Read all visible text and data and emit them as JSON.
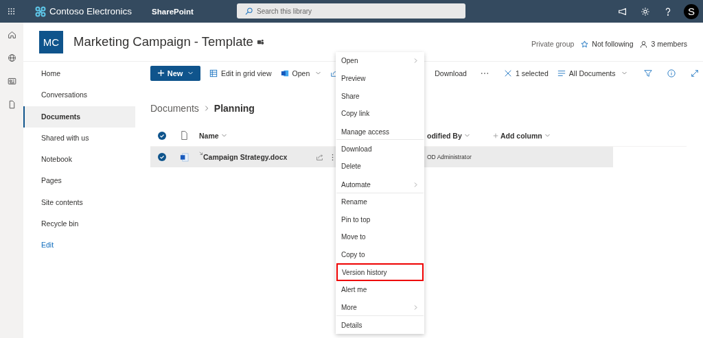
{
  "top_bar": {
    "app_name": "Contoso Electronics",
    "product": "SharePoint",
    "search": {
      "placeholder": "Search this library"
    },
    "avatar": "S"
  },
  "site": {
    "initials": "MC",
    "title": "Marketing Campaign - Template",
    "privacy": "Private group",
    "follow": "Not following",
    "members": "3 members"
  },
  "nav": {
    "items": [
      {
        "label": "Home",
        "selected": false,
        "kind": "item"
      },
      {
        "label": "Conversations",
        "selected": false,
        "kind": "item"
      },
      {
        "label": "Documents",
        "selected": true,
        "kind": "item"
      },
      {
        "label": "Shared with us",
        "selected": false,
        "kind": "item"
      },
      {
        "label": "Notebook",
        "selected": false,
        "kind": "item"
      },
      {
        "label": "Pages",
        "selected": false,
        "kind": "item"
      },
      {
        "label": "Site contents",
        "selected": false,
        "kind": "item"
      },
      {
        "label": "Recycle bin",
        "selected": false,
        "kind": "item"
      },
      {
        "label": "Edit",
        "selected": false,
        "kind": "link"
      }
    ]
  },
  "command_bar": {
    "new": "New",
    "items": [
      {
        "kind": "grid",
        "label": "Edit in grid view"
      },
      {
        "kind": "word",
        "label": "Open"
      },
      {
        "kind": "share"
      },
      {
        "kind": "hidden"
      },
      {
        "kind": "plain",
        "label": "Download"
      },
      {
        "kind": "more"
      },
      {
        "kind": "clear",
        "label": "1 selected"
      },
      {
        "kind": "view",
        "label": "All Documents"
      },
      {
        "kind": "filter"
      },
      {
        "kind": "info"
      },
      {
        "kind": "expand"
      }
    ]
  },
  "breadcrumb": [
    "Documents",
    "Planning"
  ],
  "table": {
    "all_checked": true,
    "columns": [
      {
        "label": "Name"
      },
      {
        "label": "odified By"
      },
      {
        "label": "Add column"
      }
    ],
    "rows": [
      {
        "selected": true,
        "name": "Campaign Strategy.docx",
        "modified_by": "OD Administrator"
      }
    ]
  },
  "context_menu": {
    "items": [
      {
        "label": "Open",
        "submenu": true,
        "highlighted": false,
        "separator_after": false
      },
      {
        "label": "Preview",
        "submenu": false,
        "highlighted": false,
        "separator_after": false
      },
      {
        "label": "Share",
        "submenu": false,
        "highlighted": false,
        "separator_after": false
      },
      {
        "label": "Copy link",
        "submenu": false,
        "highlighted": false,
        "separator_after": false
      },
      {
        "label": "Manage access",
        "submenu": false,
        "highlighted": false,
        "separator_after": true
      },
      {
        "label": "Download",
        "submenu": false,
        "highlighted": false,
        "separator_after": false
      },
      {
        "label": "Delete",
        "submenu": false,
        "highlighted": false,
        "separator_after": false
      },
      {
        "label": "Automate",
        "submenu": true,
        "highlighted": false,
        "separator_after": true
      },
      {
        "label": "Rename",
        "submenu": false,
        "highlighted": false,
        "separator_after": false
      },
      {
        "label": "Pin to top",
        "submenu": false,
        "highlighted": false,
        "separator_after": false
      },
      {
        "label": "Move to",
        "submenu": false,
        "highlighted": false,
        "separator_after": false
      },
      {
        "label": "Copy to",
        "submenu": false,
        "highlighted": false,
        "separator_after": false
      },
      {
        "label": "Version history",
        "submenu": false,
        "highlighted": true,
        "separator_after": false
      },
      {
        "label": "Alert me",
        "submenu": false,
        "highlighted": false,
        "separator_after": false
      },
      {
        "label": "More",
        "submenu": true,
        "highlighted": false,
        "separator_after": true
      },
      {
        "label": "Details",
        "submenu": false,
        "highlighted": false,
        "separator_after": false
      }
    ]
  }
}
